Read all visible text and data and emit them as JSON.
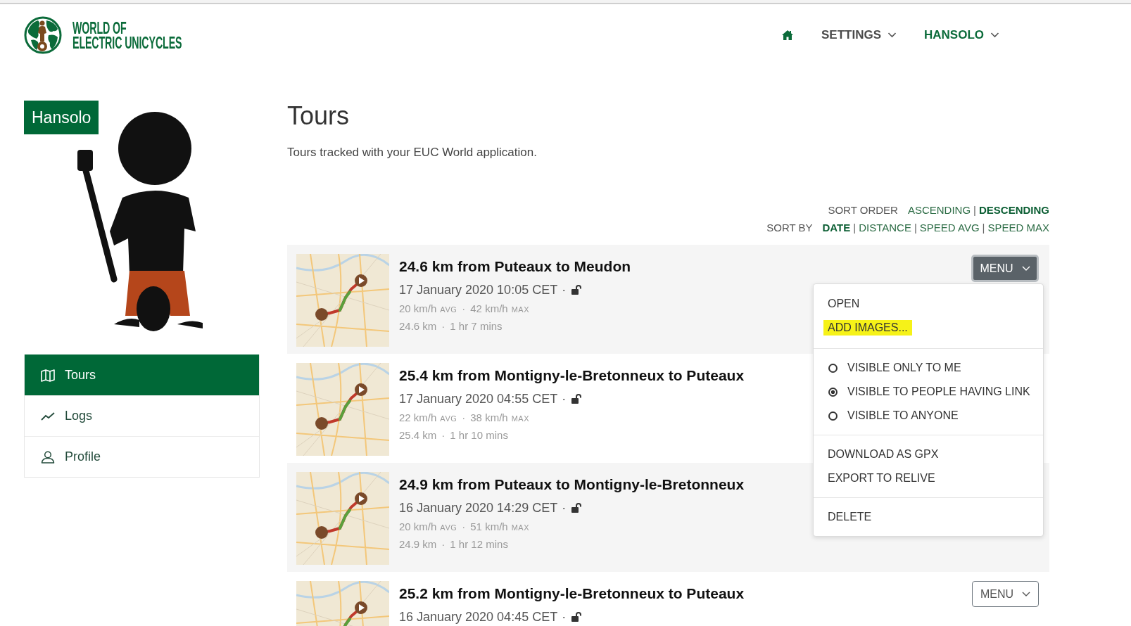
{
  "header": {
    "logo": {
      "lines": [
        "WORLD OF",
        "ELECTRIC UNICYCLES"
      ]
    },
    "nav": [
      {
        "label": "SETTINGS",
        "selected": false
      },
      {
        "label": "HANSOLO",
        "selected": true
      }
    ]
  },
  "sidebar": {
    "profile_name": "Hansolo",
    "items": [
      {
        "label": "Tours",
        "selected": true
      },
      {
        "label": "Logs",
        "selected": false
      },
      {
        "label": "Profile",
        "selected": false
      }
    ]
  },
  "page": {
    "title": "Tours",
    "subtitle": "Tours tracked with your EUC World application."
  },
  "sort_controls": [
    {
      "label": "SORT ORDER",
      "options": [
        {
          "label": "ASCENDING",
          "selected": false
        },
        {
          "separator": "|",
          "label": "DESCENDING",
          "selected": true
        }
      ]
    },
    {
      "label": "SORT BY",
      "options": [
        {
          "label": "DATE",
          "selected": true
        },
        {
          "separator": "|",
          "label": "DISTANCE",
          "selected": false
        },
        {
          "separator": "|",
          "label": "SPEED AVG",
          "selected": false
        },
        {
          "separator": "|",
          "label": "SPEED MAX",
          "selected": false
        }
      ]
    }
  ],
  "tours": [
    {
      "title": "24.6 km from Puteaux to Meudon",
      "date": "17 January 2020 10:05 CET",
      "date_separator": "·",
      "locked": false,
      "avg_speed": {
        "value": "20 km/h",
        "label": "AVG"
      },
      "speed_separator": "·",
      "max_speed": {
        "value": "42 km/h",
        "label": "MAX"
      },
      "distance": "24.6 km",
      "duration_separator": "·",
      "duration": "1 hr 7 mins",
      "menu_button": "MENU",
      "menu_open": true
    },
    {
      "title": "25.4 km from Montigny-le-Bretonneux to Puteaux",
      "date": "17 January 2020 04:55 CET",
      "date_separator": "·",
      "locked": false,
      "avg_speed": {
        "value": "22 km/h",
        "label": "AVG"
      },
      "speed_separator": "·",
      "max_speed": {
        "value": "38 km/h",
        "label": "MAX"
      },
      "distance": "25.4 km",
      "duration_separator": "·",
      "duration": "1 hr 10 mins"
    },
    {
      "title": "24.9 km from Puteaux to Montigny-le-Bretonneux",
      "date": "16 January 2020 14:29 CET",
      "date_separator": "·",
      "locked": false,
      "avg_speed": {
        "value": "20 km/h",
        "label": "AVG"
      },
      "speed_separator": "·",
      "max_speed": {
        "value": "51 km/h",
        "label": "MAX"
      },
      "distance": "24.9 km",
      "duration_separator": "·",
      "duration": "1 hr 12 mins"
    },
    {
      "title": "25.2 km from Montigny-le-Bretonneux to Puteaux",
      "date": "16 January 2020 04:45 CET",
      "date_separator": "·",
      "locked": false,
      "menu_button": "MENU",
      "menu_open": false
    }
  ],
  "tour_menu": {
    "sections": [
      {
        "items": [
          {
            "kind": "action",
            "label": "OPEN",
            "highlighted": false
          },
          {
            "kind": "action",
            "label": "ADD IMAGES...",
            "highlighted": true
          }
        ]
      },
      {
        "items": [
          {
            "kind": "radio",
            "label": "VISIBLE ONLY TO ME",
            "selected": false
          },
          {
            "kind": "radio",
            "label": "VISIBLE TO PEOPLE HAVING LINK",
            "selected": true
          },
          {
            "kind": "radio",
            "label": "VISIBLE TO ANYONE",
            "selected": false
          }
        ]
      },
      {
        "items": [
          {
            "kind": "action",
            "label": "DOWNLOAD AS GPX",
            "highlighted": false
          },
          {
            "kind": "action",
            "label": "EXPORT TO RELIVE",
            "highlighted": false
          }
        ]
      },
      {
        "items": [
          {
            "kind": "action",
            "label": "DELETE",
            "highlighted": false
          }
        ]
      }
    ]
  }
}
